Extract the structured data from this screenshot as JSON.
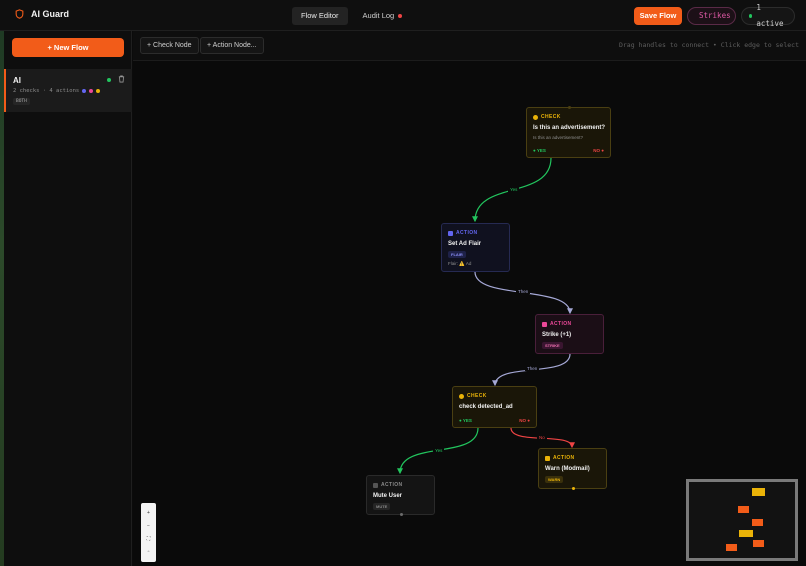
{
  "app": {
    "title": "AI Guard",
    "accent": "#f25c19"
  },
  "tabs": [
    {
      "label": "Flow Editor"
    },
    {
      "label": "Audit Log"
    }
  ],
  "header": {
    "save_label": "Save Flow",
    "strikes_label": "Strikes",
    "active_label": "1 active"
  },
  "sidebar": {
    "new_flow_label": "+ New Flow",
    "flows": [
      {
        "name": "AI",
        "meta": "2 checks · 4 actions",
        "badge": "BOTH"
      }
    ]
  },
  "toolbar": {
    "check_node_label": "+ Check Node",
    "action_node_label": "+ Action Node...",
    "hint": "Drag handles to connect • Click edge to select"
  },
  "nodes": {
    "check1": {
      "type": "CHECK",
      "title": "Is this an advertisement?",
      "sub": "Is this an advertisement?",
      "yes": "● YES",
      "no": "NO ●"
    },
    "flair": {
      "type": "ACTION",
      "title": "Set Ad Flair",
      "chip": "FLAIR",
      "sub": "Flair: ⚠️ Ad"
    },
    "strike": {
      "type": "ACTION",
      "title": "Strike (+1)",
      "chip": "STRIKE"
    },
    "check2": {
      "type": "CHECK",
      "title": "check detected_ad",
      "yes": "● YES",
      "no": "NO ●"
    },
    "warn": {
      "type": "ACTION",
      "title": "Warn (Modmail)",
      "chip": "WARN"
    },
    "mute": {
      "type": "ACTION",
      "title": "Mute User",
      "chip": "MUTE"
    }
  },
  "edges": {
    "yes1": "Yes",
    "then1": "Then",
    "then2": "Then",
    "yes2": "Yes",
    "no2": "No"
  },
  "colors": {
    "check": "#eab308",
    "flair": "#6366f1",
    "strike": "#ec4899",
    "warn": "#eab308",
    "mute": "#555555",
    "yes": "#22c55e",
    "no": "#ef4444",
    "then": "#a5a8d6"
  }
}
